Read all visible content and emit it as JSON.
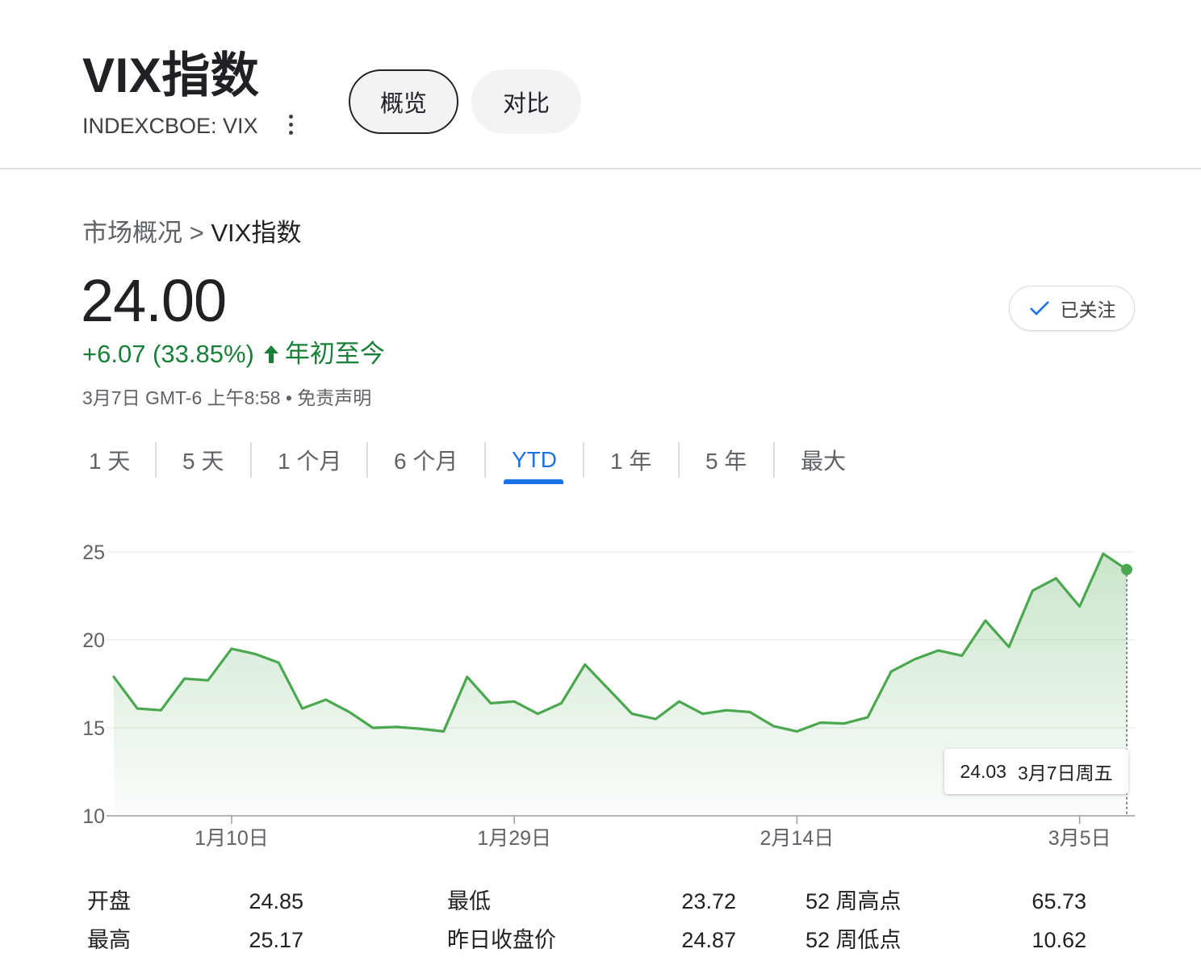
{
  "header": {
    "title": "VIX指数",
    "ticker": "INDEXCBOE: VIX",
    "tabs": [
      {
        "label": "概览",
        "selected": true
      },
      {
        "label": "对比",
        "selected": false
      }
    ]
  },
  "breadcrumb": {
    "parent": "市场概况",
    "separator": ">",
    "current": "VIX指数"
  },
  "quote": {
    "price": "24.00",
    "change": "+6.07 (33.85%)",
    "period_label": "年初至今",
    "direction": "up",
    "timestamp": "3月7日 GMT-6 上午8:58",
    "disclaimer": "免责声明",
    "dot": "•",
    "follow_label": "已关注"
  },
  "ranges": [
    {
      "label": "1 天",
      "active": false
    },
    {
      "label": "5 天",
      "active": false
    },
    {
      "label": "1 个月",
      "active": false
    },
    {
      "label": "6 个月",
      "active": false
    },
    {
      "label": "YTD",
      "active": true
    },
    {
      "label": "1 年",
      "active": false
    },
    {
      "label": "5 年",
      "active": false
    },
    {
      "label": "最大",
      "active": false
    }
  ],
  "colors": {
    "up": "#188038",
    "line": "#4ca850",
    "accent": "#1a73e8",
    "grid": "#eeeeee"
  },
  "chart_data": {
    "type": "area",
    "series": [
      {
        "values": [
          17.9,
          16.1,
          16.0,
          17.8,
          17.7,
          19.5,
          19.2,
          18.7,
          16.1,
          16.6,
          15.9,
          15.0,
          15.05,
          14.95,
          14.8,
          17.9,
          16.4,
          16.5,
          15.8,
          16.4,
          18.6,
          17.2,
          15.8,
          15.5,
          16.5,
          15.8,
          16.0,
          15.9,
          15.1,
          14.8,
          15.3,
          15.25,
          15.6,
          18.2,
          18.9,
          19.4,
          19.1,
          21.1,
          19.6,
          22.8,
          23.5,
          21.9,
          24.9,
          24.0
        ]
      }
    ],
    "y_ticks": [
      "25",
      "20",
      "15",
      "10"
    ],
    "ylim": [
      10,
      25
    ],
    "x_ticks": [
      "1月10日",
      "1月29日",
      "2月14日",
      "3月5日"
    ],
    "tooltip": {
      "value": "24.03",
      "date": "3月7日周五"
    }
  },
  "stats": [
    {
      "label": "开盘",
      "value": "24.85"
    },
    {
      "label": "最高",
      "value": "25.17"
    },
    {
      "label": "最低",
      "value": "23.72"
    },
    {
      "label": "昨日收盘价",
      "value": "24.87"
    },
    {
      "label": "52 周高点",
      "value": "65.73"
    },
    {
      "label": "52 周低点",
      "value": "10.62"
    }
  ]
}
